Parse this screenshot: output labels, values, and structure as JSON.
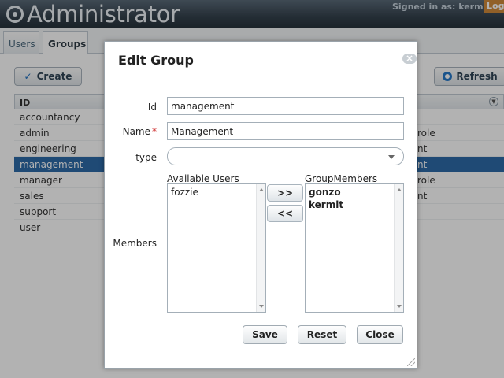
{
  "app": {
    "title": "Administrator",
    "signed_in": "Signed in as: kermit",
    "logout_label": "Logo"
  },
  "tabs": [
    {
      "label": "Users",
      "selected": false
    },
    {
      "label": "Groups",
      "selected": true
    }
  ],
  "toolbar": {
    "create_label": "Create",
    "refresh_label": "Refresh"
  },
  "grid": {
    "columns": [
      "ID"
    ],
    "rows": [
      {
        "id": "accountancy",
        "desc": ""
      },
      {
        "id": "admin",
        "desc": "role"
      },
      {
        "id": "engineering",
        "desc": "nt"
      },
      {
        "id": "management",
        "desc": "nt",
        "selected": true
      },
      {
        "id": "manager",
        "desc": "role"
      },
      {
        "id": "sales",
        "desc": "nt"
      },
      {
        "id": "support",
        "desc": ""
      },
      {
        "id": "user",
        "desc": ""
      }
    ]
  },
  "dialog": {
    "title": "Edit Group",
    "close_glyph": "×",
    "fields": {
      "id_label": "Id",
      "id_value": "management",
      "name_label": "Name",
      "name_required": "*",
      "name_value": "Management",
      "type_label": "type",
      "type_value": "",
      "members_label": "Members"
    },
    "available_users_label": "Available Users",
    "available_users": [
      "fozzie"
    ],
    "group_members_label": "GroupMembers",
    "group_members": [
      "gonzo",
      "kermit"
    ],
    "add_label": ">>",
    "remove_label": "<<",
    "save_label": "Save",
    "reset_label": "Reset",
    "close_label": "Close"
  },
  "colors": {
    "header": "#34414c",
    "selected_row": "#2d6aa8",
    "required": "#cc2222",
    "logout": "#d08a3a"
  }
}
